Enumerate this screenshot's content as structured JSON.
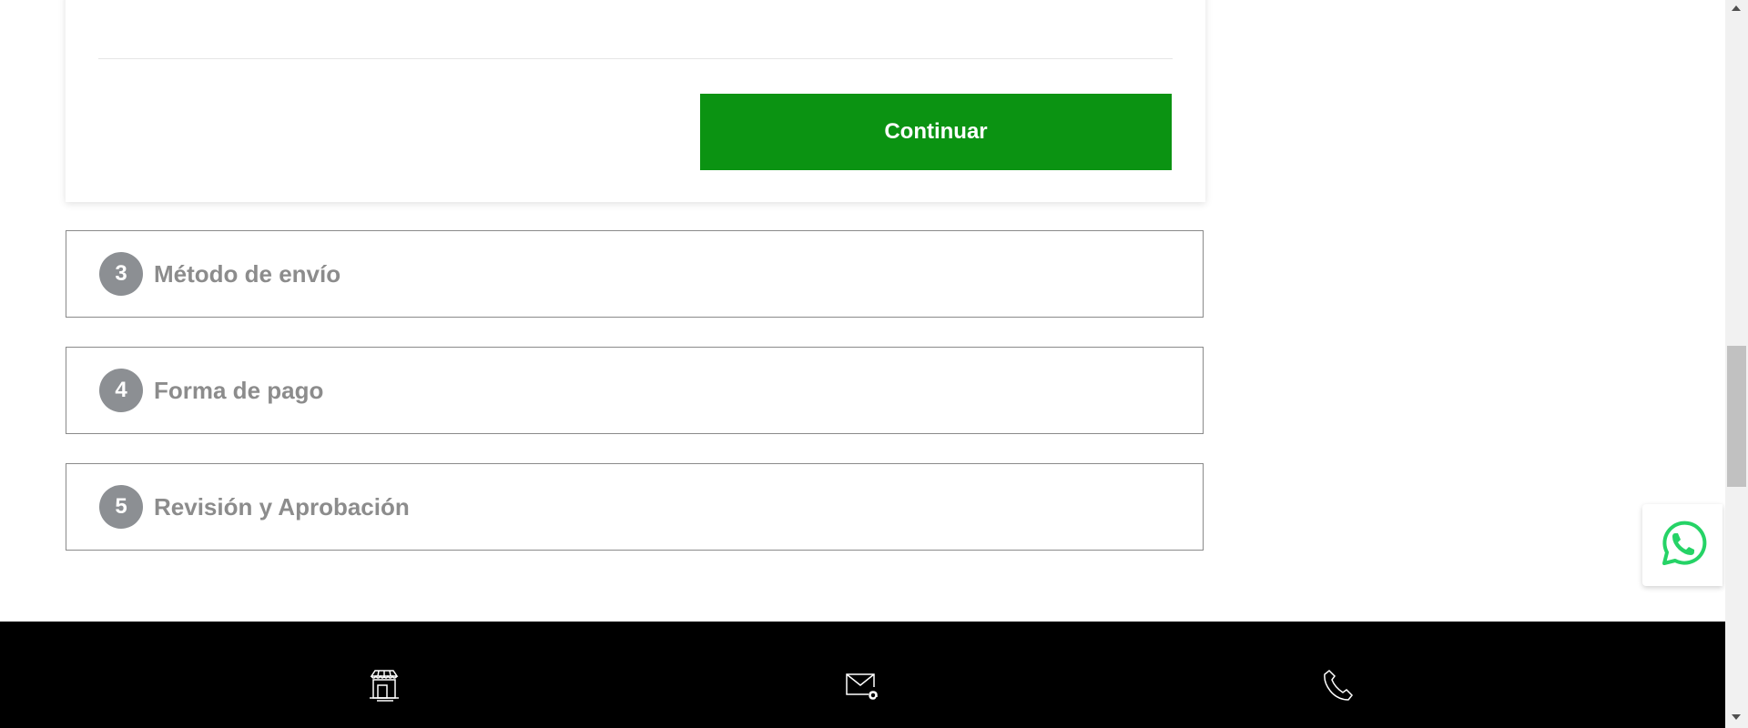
{
  "checkout": {
    "continue_label": "Continuar",
    "steps": [
      {
        "number": "3",
        "title": "Método de envío"
      },
      {
        "number": "4",
        "title": "Forma de pago"
      },
      {
        "number": "5",
        "title": "Revisión y Aprobación"
      }
    ]
  },
  "footer": {
    "icons": [
      "store-icon",
      "mail-icon",
      "phone-icon"
    ]
  },
  "widgets": {
    "whatsapp_icon": "whatsapp-icon"
  },
  "colors": {
    "primary_green": "#0b9312",
    "step_badge": "#8c8f93",
    "step_text": "#8c8c8c",
    "footer_bg": "#000000",
    "whatsapp_green": "#25d366"
  }
}
